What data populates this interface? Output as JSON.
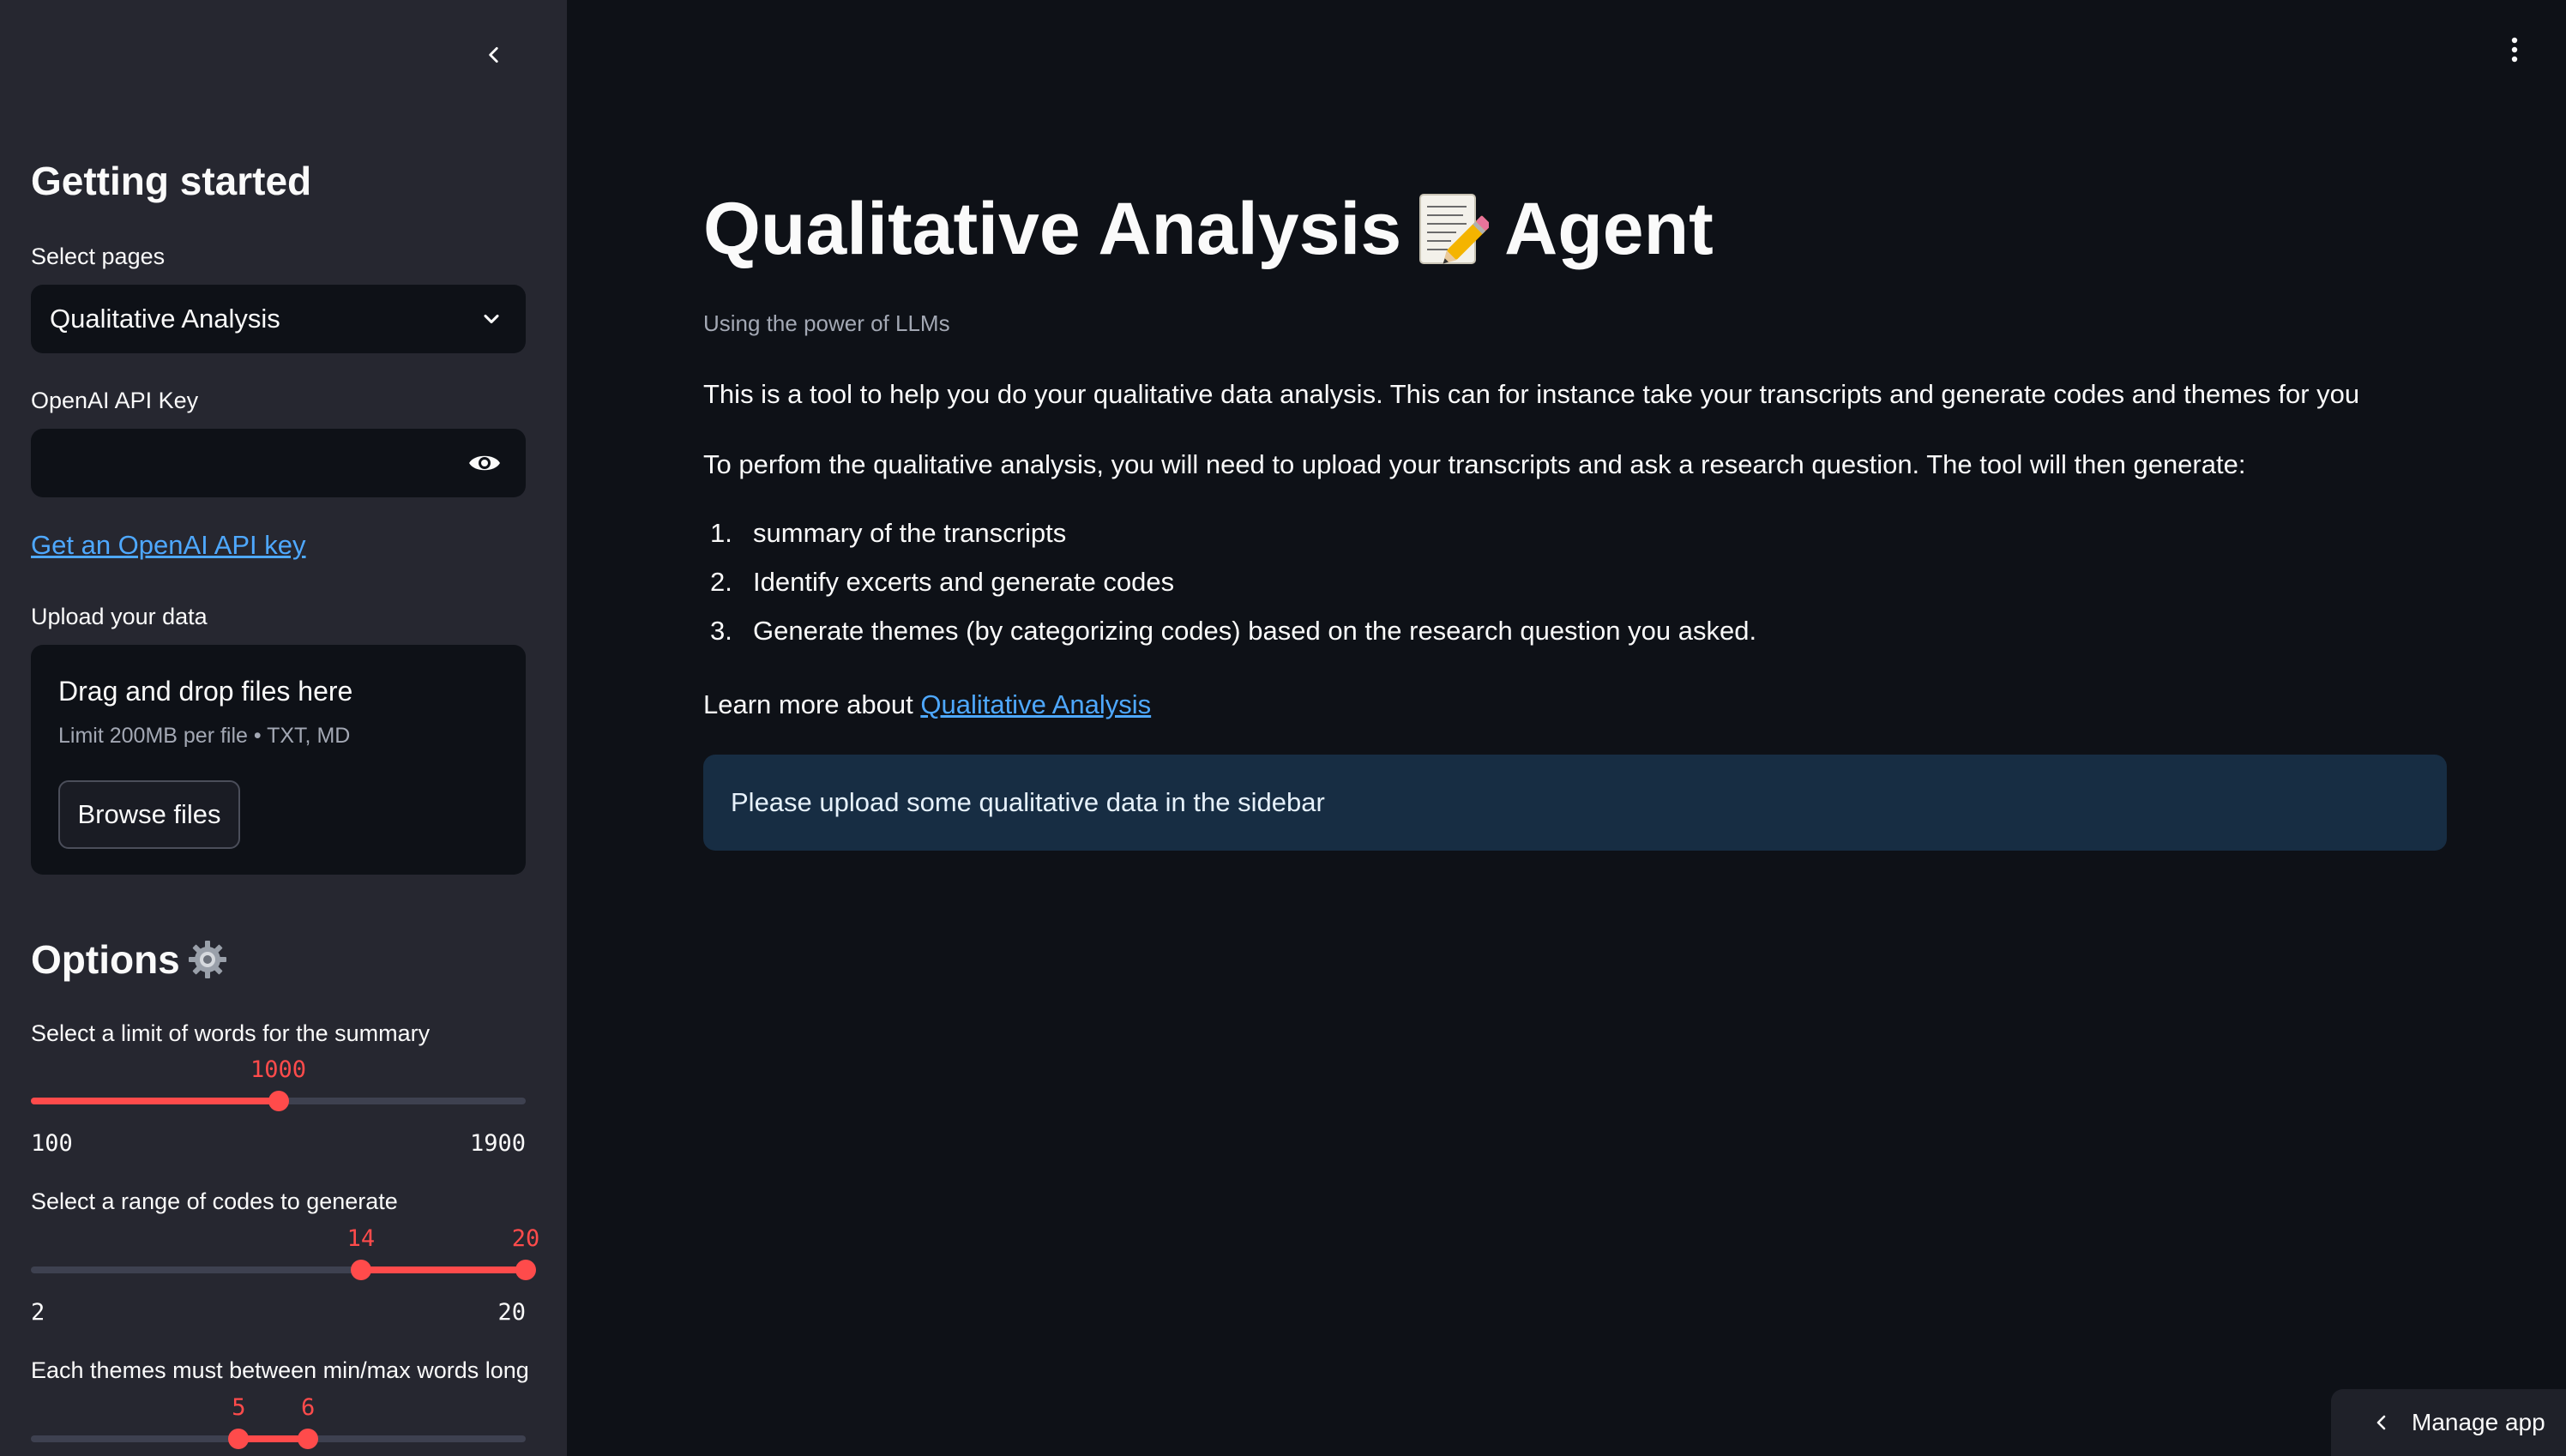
{
  "sidebar": {
    "heading": "Getting started",
    "select_pages_label": "Select pages",
    "select_pages_value": "Qualitative Analysis",
    "api_key_label": "OpenAI API Key",
    "api_key_value": "",
    "api_key_link": "Get an OpenAI API key",
    "upload_label": "Upload your data",
    "upload_title": "Drag and drop files here",
    "upload_limit": "Limit 200MB per file • TXT, MD",
    "browse_label": "Browse files",
    "options_heading": "Options",
    "slider_words": {
      "label": "Select a limit of words for the summary",
      "value": "1000",
      "min": "100",
      "max": "1900",
      "fraction": 0.5
    },
    "slider_codes": {
      "label": "Select a range of codes to generate",
      "low": "14",
      "high": "20",
      "min": "2",
      "max": "20",
      "low_fraction": 0.667,
      "high_fraction": 1.0
    },
    "slider_themes": {
      "label": "Each themes must between min/max words long",
      "low": "5",
      "high": "6",
      "low_fraction": 0.42,
      "high_fraction": 0.56
    }
  },
  "main": {
    "title_left": "Qualitative Analysis",
    "title_right": "Agent",
    "caption": "Using the power of LLMs",
    "intro": "This is a tool to help you do your qualitative data analysis. This can for instance take your transcripts and generate codes and themes for you",
    "instructions": "To perfom the qualitative analysis, you will need to upload your transcripts and ask a research question. The tool will then generate:",
    "steps": [
      {
        "num": "1.",
        "text": "summary of the transcripts"
      },
      {
        "num": "2.",
        "text": "Identify excerts and generate codes"
      },
      {
        "num": "3.",
        "text": "Generate themes (by categorizing codes) based on the research question you asked."
      }
    ],
    "learn_more_prefix": "Learn more about",
    "learn_more_link": "Qualitative Analysis",
    "info_message": "Please upload some qualitative data in the sidebar"
  },
  "footer": {
    "manage_app": "Manage app"
  },
  "colors": {
    "accent": "#ff4b4b",
    "link": "#4ea8ff",
    "sidebar_bg": "#262730",
    "main_bg": "#0e1117",
    "info_bg": "#172d43"
  },
  "icons": [
    "chevron-left-icon",
    "chevron-down-icon",
    "eye-icon",
    "gear-icon",
    "memo-icon",
    "kebab-menu-icon"
  ]
}
